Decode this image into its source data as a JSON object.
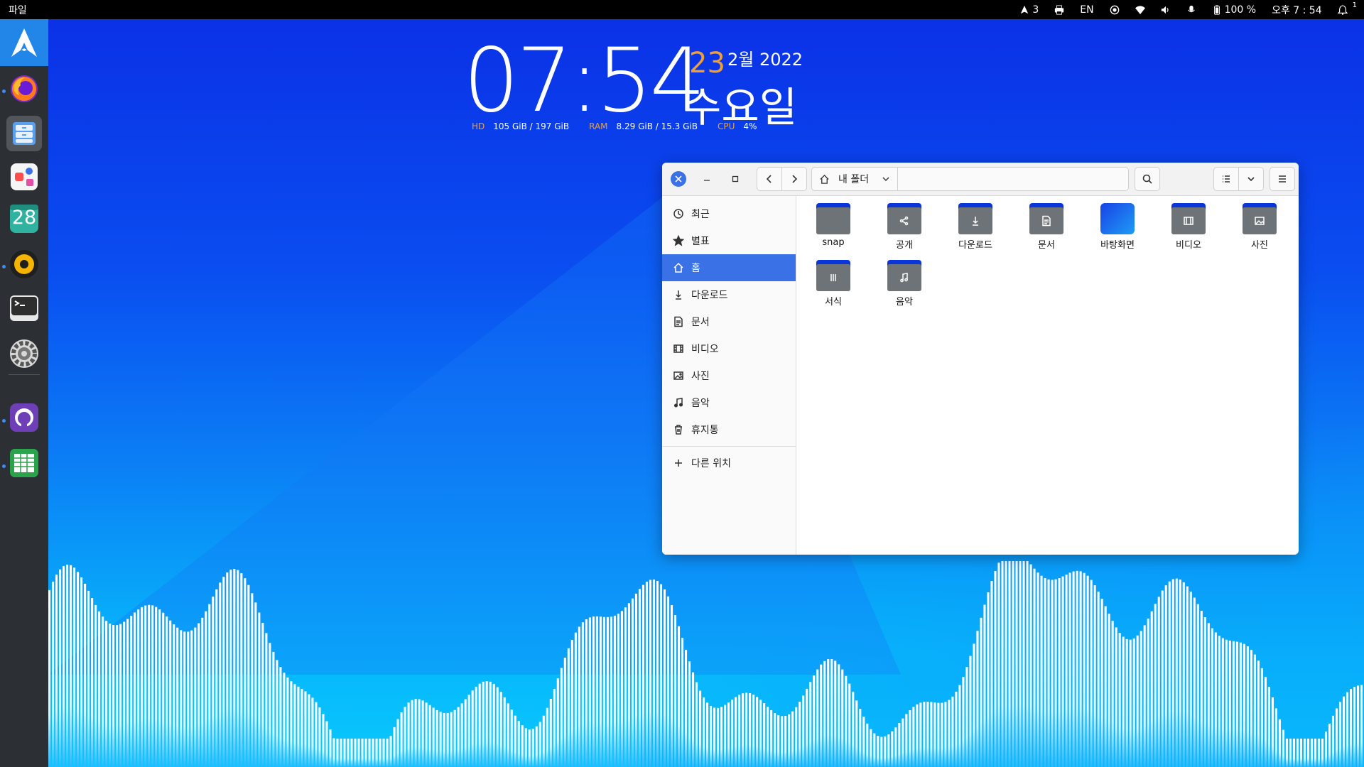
{
  "topbar": {
    "app_title": "파일",
    "steam_count": "3",
    "lang": "EN",
    "battery": "100 %",
    "time": "오후 7 : 54",
    "notif_count": "1"
  },
  "clock": {
    "time": "07:54",
    "day": "23",
    "month_year": "2월 2022",
    "weekday": "수요일",
    "hd_label": "HD",
    "hd_value": "105 GiB / 197 GiB",
    "ram_label": "RAM",
    "ram_value": "8.29 GiB / 15.3 GiB",
    "cpu_label": "CPU",
    "cpu_value": "4%"
  },
  "dock": {
    "calendar_day": "28"
  },
  "window": {
    "path_label": "내 폴더",
    "sidebar": {
      "recent": "최근",
      "starred": "별표",
      "home": "홈",
      "downloads": "다운로드",
      "documents": "문서",
      "videos": "비디오",
      "pictures": "사진",
      "music": "음악",
      "trash": "휴지통",
      "other": "다른 위치"
    },
    "files": {
      "snap": "snap",
      "public": "공개",
      "downloads": "다운로드",
      "documents": "문서",
      "desktop": "바탕화면",
      "videos": "비디오",
      "pictures": "사진",
      "templates": "서식",
      "music": "음악"
    }
  },
  "colors": {
    "accent": "#3a71e6",
    "clock_accent": "#f0a030",
    "dock_bg": "#2c3035"
  }
}
